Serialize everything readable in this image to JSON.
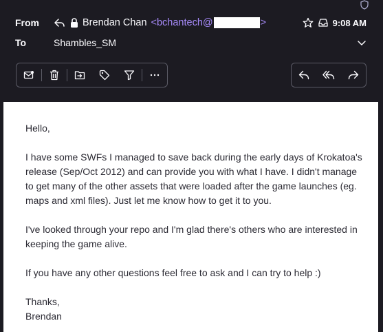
{
  "header": {
    "from_label": "From",
    "to_label": "To",
    "sender_name": "Brendan Chan",
    "sender_email_prefix": "<bchantech@",
    "sender_email_suffix": ">",
    "time": "9:08 AM",
    "recipient": "Shambles_SM"
  },
  "toolbar": {
    "left_icons": [
      "mark-read-icon",
      "delete-icon",
      "archive-icon",
      "tag-icon",
      "filter-icon",
      "more-icon"
    ],
    "right_icons": [
      "reply-icon",
      "reply-all-icon",
      "forward-icon"
    ]
  },
  "message": {
    "greeting": "Hello,",
    "paragraph1": "I have some SWFs I managed to save back during the early days of Krokatoa's release (Sep/Oct 2012) and can provide you with what I have. I didn't manage to get many of the other assets that were loaded after the game launches (eg. maps and xml files). Just let me know how to get it to you.",
    "paragraph2": "I've looked through your repo and I'm glad there's others who are interested in keeping the game alive.",
    "paragraph3": "If you have any other questions feel free to ask and I can try to help :)",
    "closing": "Thanks,",
    "signature": "Brendan"
  },
  "colors": {
    "header_bg": "#1c1b22",
    "email_accent": "#a78bfa",
    "body_bg": "#ffffff",
    "text_dark": "#2b2a33"
  }
}
